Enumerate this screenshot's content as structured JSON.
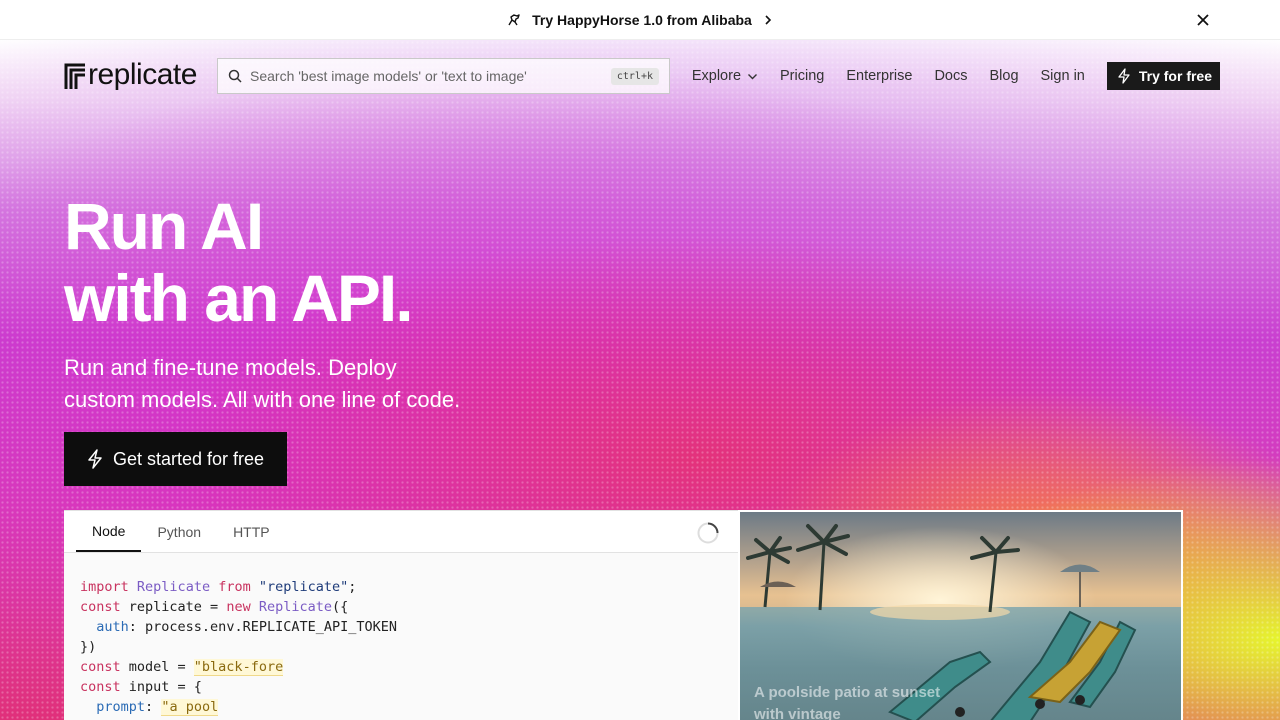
{
  "announcement": {
    "text": "Try HappyHorse 1.0 from Alibaba",
    "icon": "horse-icon"
  },
  "nav": {
    "logo_text": "replicate",
    "search_placeholder": "Search 'best image models' or 'text to image'",
    "search_shortcut": "ctrl+k",
    "links": {
      "explore": "Explore",
      "pricing": "Pricing",
      "enterprise": "Enterprise",
      "docs": "Docs",
      "blog": "Blog",
      "signin": "Sign in"
    },
    "cta": "Try for free"
  },
  "hero": {
    "title_line1": "Run AI",
    "title_line2": "with an API.",
    "subtitle_line1": "Run and fine-tune models. Deploy",
    "subtitle_line2": "custom models. All with one line of code.",
    "cta": "Get started for free"
  },
  "code_panel": {
    "tabs": [
      "Node",
      "Python",
      "HTTP"
    ],
    "active_tab": "Node",
    "lines": {
      "l1a": "import",
      "l1b": "Replicate",
      "l1c": "from",
      "l1d": "\"replicate\"",
      "l1e": ";",
      "l2a": "const",
      "l2b": " replicate = ",
      "l2c": "new",
      "l2d": "Replicate",
      "l2e": "({",
      "l3a": "auth",
      "l3b": ": process.env.REPLICATE_API_TOKEN",
      "l4": "})",
      "l5a": "const",
      "l5b": " model = ",
      "l5c": "\"black-fore",
      "l6a": "const",
      "l6b": " input = {",
      "l7a": "prompt",
      "l7b": ": ",
      "l7c": "\"a pool"
    }
  },
  "image_panel": {
    "caption": "A poolside patio at sunset with vintage"
  },
  "colors": {
    "accent_dark": "#0d0d0d",
    "keyword": "#c8325f",
    "class": "#7b5cc4",
    "property": "#2b6bb5"
  }
}
